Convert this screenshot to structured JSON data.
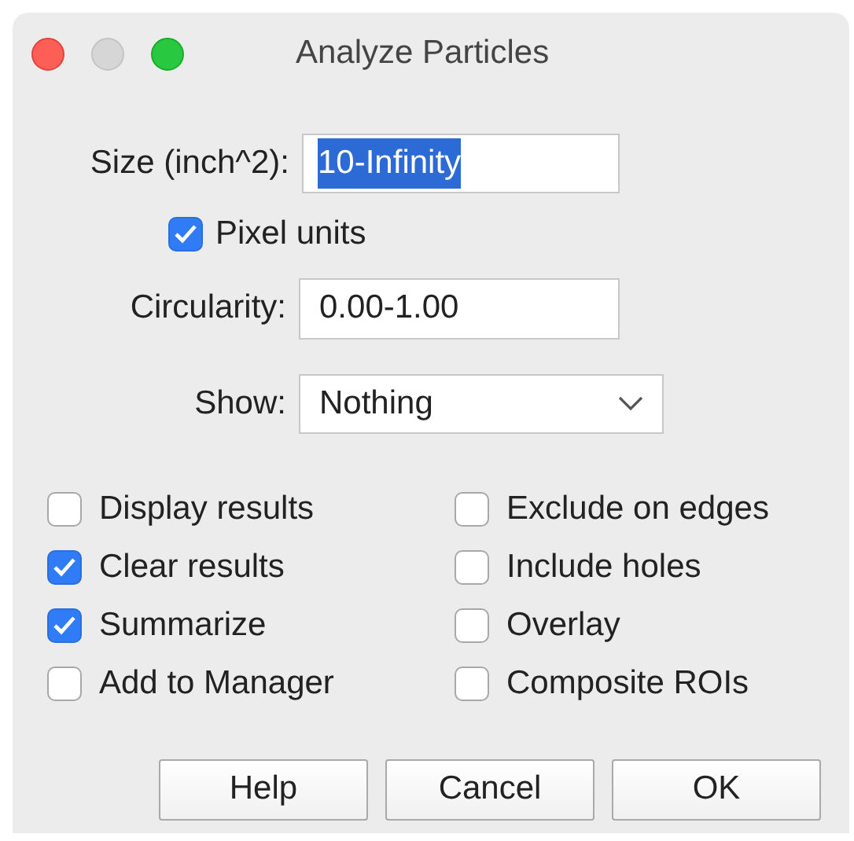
{
  "window": {
    "title": "Analyze Particles"
  },
  "size": {
    "label": "Size (inch^2):",
    "value": "10-Infinity",
    "selected": true
  },
  "pixel_units": {
    "label": "Pixel units",
    "checked": true
  },
  "circularity": {
    "label": "Circularity:",
    "value": "0.00-1.00"
  },
  "show": {
    "label": "Show:",
    "value": "Nothing"
  },
  "options": [
    {
      "label": "Display results",
      "checked": false
    },
    {
      "label": "Exclude on edges",
      "checked": false
    },
    {
      "label": "Clear results",
      "checked": true
    },
    {
      "label": "Include holes",
      "checked": false
    },
    {
      "label": "Summarize",
      "checked": true
    },
    {
      "label": "Overlay",
      "checked": false
    },
    {
      "label": "Add to Manager",
      "checked": false
    },
    {
      "label": "Composite ROIs",
      "checked": false
    }
  ],
  "buttons": [
    "Help",
    "Cancel",
    "OK"
  ]
}
